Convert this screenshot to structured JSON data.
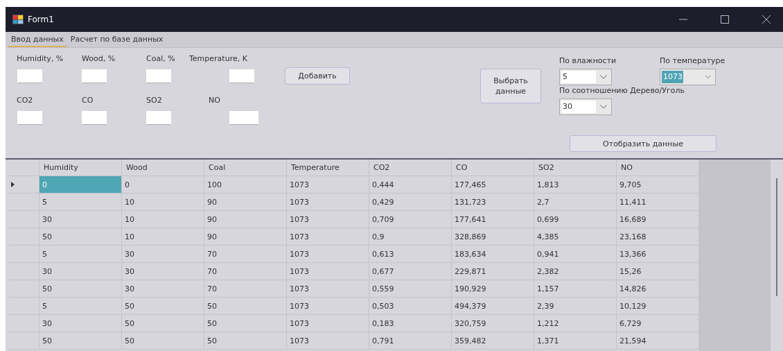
{
  "window": {
    "title": "Form1"
  },
  "tabs": [
    {
      "label": "Ввод данных",
      "selected": true
    },
    {
      "label": "Расчет по базе данных",
      "selected": false
    }
  ],
  "inputs": [
    {
      "label": "Humidity, %"
    },
    {
      "label": "Wood, %"
    },
    {
      "label": "Coal, %"
    },
    {
      "label": "Temperature, K"
    },
    {
      "label": "CO2"
    },
    {
      "label": "CO"
    },
    {
      "label": "SO2"
    },
    {
      "label": "NO"
    }
  ],
  "add_button": "Добавить",
  "select_button": "Выбрать данные",
  "filters": [
    {
      "label": "По влажности",
      "value": "5",
      "highlighted": false
    },
    {
      "label": "По температуре",
      "value": "1073",
      "highlighted": true
    },
    {
      "label": "По соотношению Дерево/Уголь",
      "value": "30",
      "highlighted": false
    }
  ],
  "show_button": "Отобразить данные",
  "table": {
    "columns": [
      "Humidity",
      "Wood",
      "Coal",
      "Temperature",
      "CO2",
      "CO",
      "SO2",
      "NO"
    ],
    "rows": [
      {
        "selected": true,
        "cells": [
          "0",
          "0",
          "100",
          "1073",
          "0,444",
          "177,465",
          "1,813",
          "9,705"
        ]
      },
      {
        "selected": false,
        "cells": [
          "5",
          "10",
          "90",
          "1073",
          "0,429",
          "131,723",
          "2,7",
          "11,411"
        ]
      },
      {
        "selected": false,
        "cells": [
          "30",
          "10",
          "90",
          "1073",
          "0,709",
          "177,641",
          "0,699",
          "16,689"
        ]
      },
      {
        "selected": false,
        "cells": [
          "50",
          "10",
          "90",
          "1073",
          "0,9",
          "328,869",
          "4,385",
          "23,168"
        ]
      },
      {
        "selected": false,
        "cells": [
          "5",
          "30",
          "70",
          "1073",
          "0,613",
          "183,634",
          "0,941",
          "13,366"
        ]
      },
      {
        "selected": false,
        "cells": [
          "30",
          "30",
          "70",
          "1073",
          "0,677",
          "229,871",
          "2,382",
          "15,26"
        ]
      },
      {
        "selected": false,
        "cells": [
          "50",
          "30",
          "70",
          "1073",
          "0,559",
          "190,929",
          "1,157",
          "14,826"
        ]
      },
      {
        "selected": false,
        "cells": [
          "5",
          "50",
          "50",
          "1073",
          "0,503",
          "494,379",
          "2,39",
          "10,129"
        ]
      },
      {
        "selected": false,
        "cells": [
          "30",
          "50",
          "50",
          "1073",
          "0,183",
          "320,759",
          "1,212",
          "6,729"
        ]
      },
      {
        "selected": false,
        "cells": [
          "50",
          "50",
          "50",
          "1073",
          "0,791",
          "359,482",
          "1,371",
          "21,594"
        ]
      }
    ]
  }
}
